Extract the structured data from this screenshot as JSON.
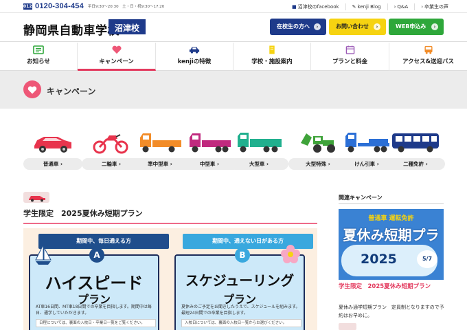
{
  "topbar": {
    "free_dial": "0120",
    "phone": "0120-304-454",
    "hours": "平日9:30〜20:30　土・日・祝9:30〜17:20",
    "links": [
      "沼津校のfacebook",
      "kenji Blog",
      "Q&A",
      "卒業生の声"
    ]
  },
  "header": {
    "logo": "静岡県自動車学校",
    "campus": "沼津校",
    "buttons": [
      {
        "label": "在校生の方へ"
      },
      {
        "label": "お問い合わせ"
      },
      {
        "label": "WEB申込み"
      }
    ]
  },
  "nav": {
    "items": [
      {
        "label": "お知らせ"
      },
      {
        "label": "キャンペーン"
      },
      {
        "label": "kenjiの特徴"
      },
      {
        "label": "学校・施設案内"
      },
      {
        "label": "プランと料金"
      },
      {
        "label": "アクセス&送迎バス"
      }
    ]
  },
  "page": {
    "title": "キャンペーン"
  },
  "vehicles": [
    {
      "label": "普通車 ›"
    },
    {
      "label": "二輪車 ›"
    },
    {
      "label": "準中型車 ›"
    },
    {
      "label": "中型車 ›"
    },
    {
      "label": "大型車 ›"
    },
    {
      "label": "大型特殊 ›"
    },
    {
      "label": "けん引車 ›"
    },
    {
      "label": "二種免許 ›"
    }
  ],
  "campaign": {
    "title": "学生限定　2025夏休み短期プラン",
    "poster": {
      "a": {
        "header": "期間中、毎日通える方",
        "badge": "A",
        "title1": "ハイスピード",
        "title2": "プラン",
        "desc": "AT車16日間、MT車18日間での卒業を目指します。期間中は毎日、通学していただきます。",
        "note": "日程については、裏面の入校日・卒業日一覧をご覧ください。"
      },
      "b": {
        "header": "期間中、通えない日がある方",
        "badge": "B",
        "title1": "スケジューリング",
        "title2": "プラン",
        "desc": "夏休みのご予定をお聞きしたうえで、スケジュールを組みます。最短24日間での卒業を目指します。",
        "note": "入校日については、裏面の入校日一覧からお選びください。"
      }
    }
  },
  "related": {
    "title": "関連キャンペーン",
    "image": {
      "line1": "普通車 運転免許",
      "line2": "夏休み短期プラン",
      "year": "2025",
      "date": "5/7"
    },
    "link": "学生限定　2025夏休み短期プラン",
    "text": "夏休み通学短期プラン　定員制となりますので予約はお早めに。"
  },
  "colors": {
    "navy": "#1e3a8a",
    "pink": "#e33a5e",
    "yellow": "#f6d311",
    "green": "#2ea73a"
  }
}
